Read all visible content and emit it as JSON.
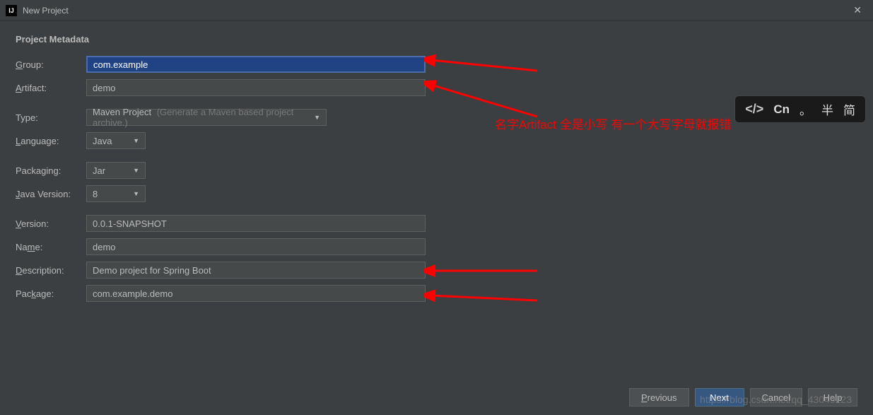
{
  "window": {
    "title": "New Project",
    "icon_label": "IJ"
  },
  "section_title": "Project Metadata",
  "labels": {
    "group": "Group:",
    "artifact": "Artifact:",
    "type": "Type:",
    "language": "Language:",
    "packaging": "Packaging:",
    "java_version": "Java Version:",
    "version": "Version:",
    "name": "Name:",
    "description": "Description:",
    "package": "Package:"
  },
  "underlined": {
    "group": "G",
    "artifact": "A",
    "language": "L",
    "java_version": "J",
    "version": "V",
    "name": "m",
    "description": "D",
    "package": "k"
  },
  "values": {
    "group": "com.example",
    "artifact": "demo",
    "type": "Maven Project",
    "type_hint": "(Generate a Maven based project archive.)",
    "language": "Java",
    "packaging": "Jar",
    "java_version": "8",
    "version": "0.0.1-SNAPSHOT",
    "name": "demo",
    "description": "Demo project for Spring Boot",
    "package": "com.example.demo"
  },
  "annotation": {
    "text": "名字Artifact 全是小写 有一个大写字母就报错"
  },
  "ime": {
    "cn": "Cn",
    "dot": "。",
    "half": "半",
    "simple": "简"
  },
  "buttons": {
    "previous": "Previous",
    "next": "Next",
    "cancel": "Cancel",
    "help": "Help"
  },
  "watermark": "https://blog.csdn.net/qq_43049223"
}
